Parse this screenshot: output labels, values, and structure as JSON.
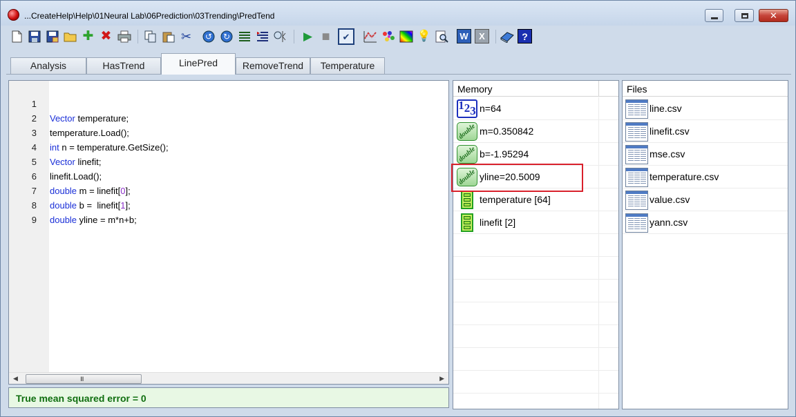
{
  "window": {
    "title": "...CreateHelp\\Help\\01Neural Lab\\06Prediction\\03Trending\\PredTend",
    "minimize_glyph": "",
    "close_glyph": "✕"
  },
  "toolbar": {
    "icons": [
      "new-document-icon",
      "save-icon",
      "save-as-icon",
      "open-folder-icon",
      "add-icon",
      "delete-icon",
      "print-icon",
      "copy-icon",
      "paste-icon",
      "cut-icon",
      "undo-icon",
      "redo-icon",
      "indent-icon",
      "outdent-icon",
      "find-icon",
      "run-icon",
      "stop-icon",
      "check-icon",
      "chart-icon",
      "palette-icon",
      "spectrum-icon",
      "bulb-icon",
      "preview-icon",
      "word-icon",
      "excel-icon",
      "book-icon",
      "help-icon"
    ],
    "glyphs": {
      "add": "✚",
      "delete": "✖",
      "cut": "✂",
      "undo": "↺",
      "redo": "↻",
      "run": "▶",
      "stop": "■",
      "check": "✔",
      "bulb": "💡",
      "word": "W",
      "excel": "X",
      "help": "?"
    }
  },
  "tabs": [
    {
      "label": "Analysis",
      "active": false
    },
    {
      "label": "HasTrend",
      "active": false
    },
    {
      "label": "LinePred",
      "active": true
    },
    {
      "label": "RemoveTrend",
      "active": false
    },
    {
      "label": "Temperature",
      "active": false
    }
  ],
  "editor": {
    "lines": [
      {
        "num": "1",
        "kw": "Vector",
        "rest": " temperature;"
      },
      {
        "num": "2",
        "text": "temperature.Load();"
      },
      {
        "num": "3",
        "kw": "int",
        "rest": " n = temperature.GetSize();"
      },
      {
        "num": "4",
        "kw": "Vector",
        "rest": " linefit;"
      },
      {
        "num": "5",
        "text": "linefit.Load();"
      },
      {
        "num": "6",
        "kw": "double",
        "mid": " m = linefit[",
        "idx": "0",
        "tail": "];"
      },
      {
        "num": "7",
        "kw": "double",
        "mid": " b =  linefit[",
        "idx": "1",
        "tail": "];"
      },
      {
        "num": "8",
        "kw": "double",
        "rest": " yline = m*n+b;"
      },
      {
        "num": "9",
        "text": ""
      }
    ],
    "scroll_grip": "III",
    "scroll_left": "◀",
    "scroll_right": "▶"
  },
  "status": {
    "text": "True mean squared error = 0"
  },
  "memory": {
    "header": "Memory",
    "items": [
      {
        "type": "int",
        "icon_text": "123",
        "label": "n=64"
      },
      {
        "type": "double",
        "icon_text": "double",
        "label": "m=0.350842"
      },
      {
        "type": "double",
        "icon_text": "double",
        "label": "b=-1.95294"
      },
      {
        "type": "double",
        "icon_text": "double",
        "label": "yline=20.5009"
      },
      {
        "type": "vector",
        "label": "temperature [64]"
      },
      {
        "type": "vector",
        "label": "linefit [2]"
      }
    ]
  },
  "files": {
    "header": "Files",
    "items": [
      {
        "label": "line.csv"
      },
      {
        "label": "linefit.csv"
      },
      {
        "label": "mse.csv"
      },
      {
        "label": "temperature.csv"
      },
      {
        "label": "value.csv"
      },
      {
        "label": "yann.csv"
      }
    ]
  },
  "colors": {
    "keyword": "#1a2fd8",
    "number": "#8a2ec8",
    "status": "#0f6e0f",
    "highlight": "#d9202b"
  }
}
